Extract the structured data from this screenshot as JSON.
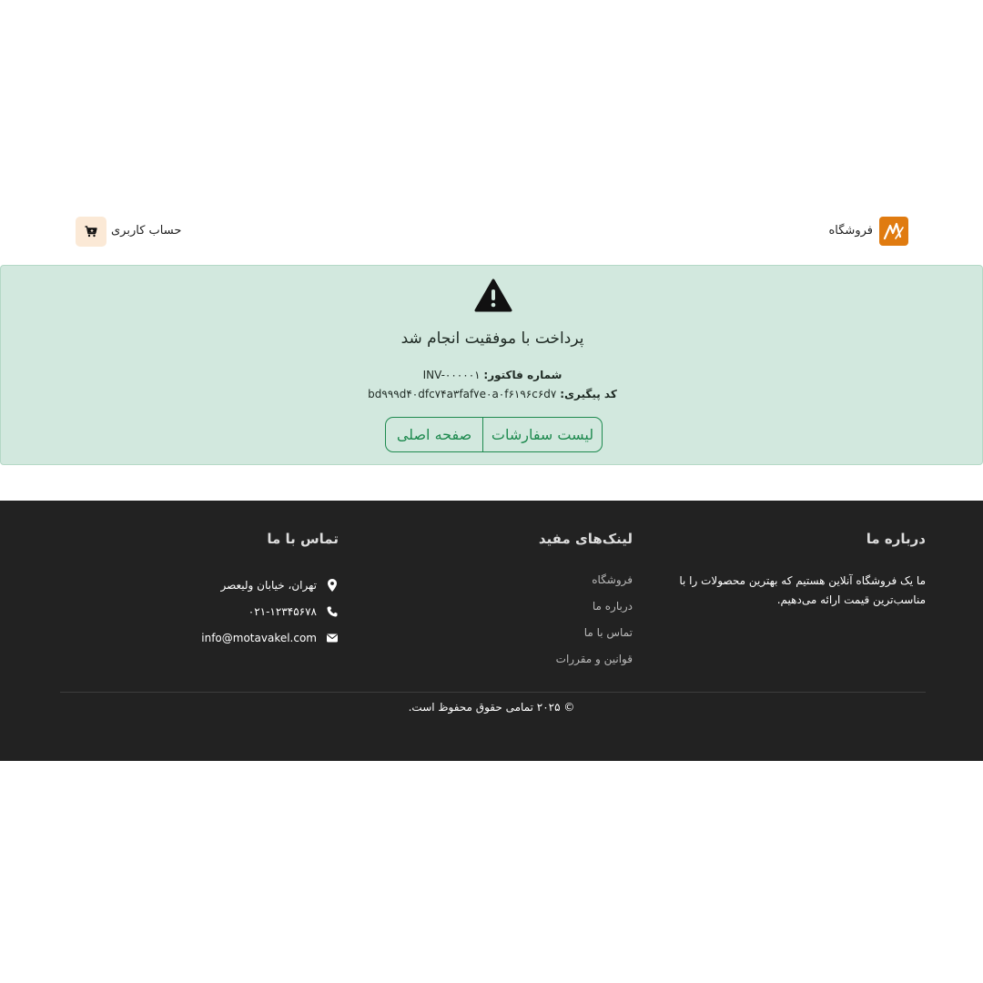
{
  "header": {
    "brand_label": "فروشگاه",
    "account_label": "حساب کاربری",
    "logo_color": "#e07b10",
    "cart_icon": "cart-icon"
  },
  "alert": {
    "icon": "warning-icon",
    "title": "پرداخت با موفقیت انجام شد",
    "invoice_label": "شماره فاکتور:",
    "invoice_value": "INV-۰۰۰۰۰۱",
    "tracking_label": "کد پیگیری:",
    "tracking_value": "bd۹۹۹d۴۰dfc۷۴a۳faf۷e۰a۰f۶۱۹۶c۶d۷",
    "orders_button": "لیست سفارشات",
    "home_button": "صفحه اصلی",
    "bg_color": "#d2e8de",
    "accent_color": "#1e8a4f"
  },
  "footer": {
    "about_title": "درباره ما",
    "about_text": "ما یک فروشگاه آنلاین هستیم که بهترین محصولات را با مناسب‌ترین قیمت ارائه می‌دهیم.",
    "links_title": "لینک‌های مفید",
    "links": [
      "فروشگاه",
      "درباره ما",
      "تماس با ما",
      "قوانین و مقررات"
    ],
    "contact_title": "تماس با ما",
    "address": "تهران، خیابان ولیعصر",
    "phone": "۰۲۱-۱۲۳۴۵۶۷۸",
    "email": "info@motavakel.com",
    "copyright": "© ۲۰۲۵ تمامی حقوق محفوظ است.",
    "bg_color": "#222222"
  }
}
